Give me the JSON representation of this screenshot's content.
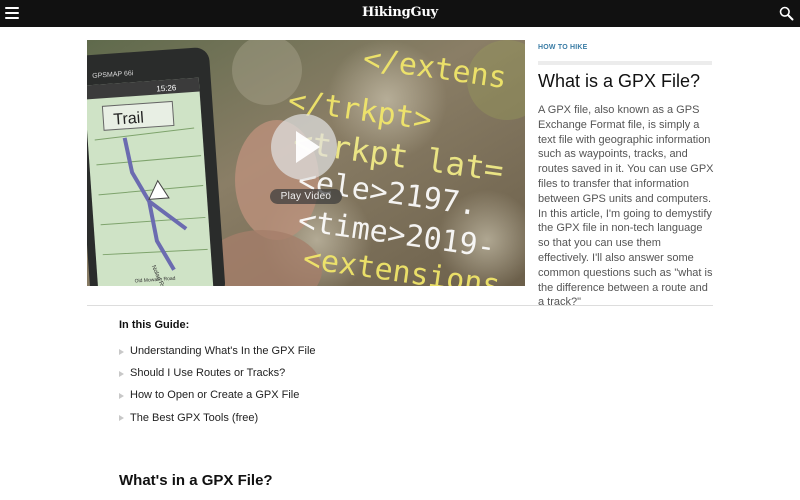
{
  "header": {
    "logo": "HikingGuy",
    "menu_icon": "hamburger-menu-icon",
    "search_icon": "search-icon"
  },
  "hero": {
    "play_label": "Play Video",
    "overlay_code": [
      "</extens",
      "</trkpt>",
      "<trkpt lat=",
      "<ele>2197.",
      "<time>2019-",
      "<extensions"
    ],
    "gps_device": {
      "model": "GPSMAP 66i",
      "time": "15:26",
      "track_label": "Trail",
      "road_label": "Old Mowalin Road",
      "road_label2": "Nolan Road"
    }
  },
  "article": {
    "category": "HOW TO HIKE",
    "title": "What is a GPX File?",
    "intro": "A GPX file, also known as a GPS Exchange Format file, is simply a text file with geographic information such as waypoints, tracks, and routes saved in it. You can use GPX files to transfer that information between GPS units and computers. In this article, I'm going to demystify the GPX file in non-tech language so that you can use them effectively. I'll also answer some common questions such as \"what is the difference between a route and a track?\""
  },
  "guide": {
    "heading": "In this Guide:",
    "items": [
      "Understanding What's In the GPX File",
      "Should I Use Routes or Tracks?",
      "How to Open or Create a GPX File",
      "The Best GPX Tools (free)"
    ]
  },
  "section": {
    "heading": "What's in a GPX File?"
  },
  "colors": {
    "topbar": "#111111",
    "kicker": "#3a7ca5",
    "overlay_text": "#f4e96a"
  }
}
